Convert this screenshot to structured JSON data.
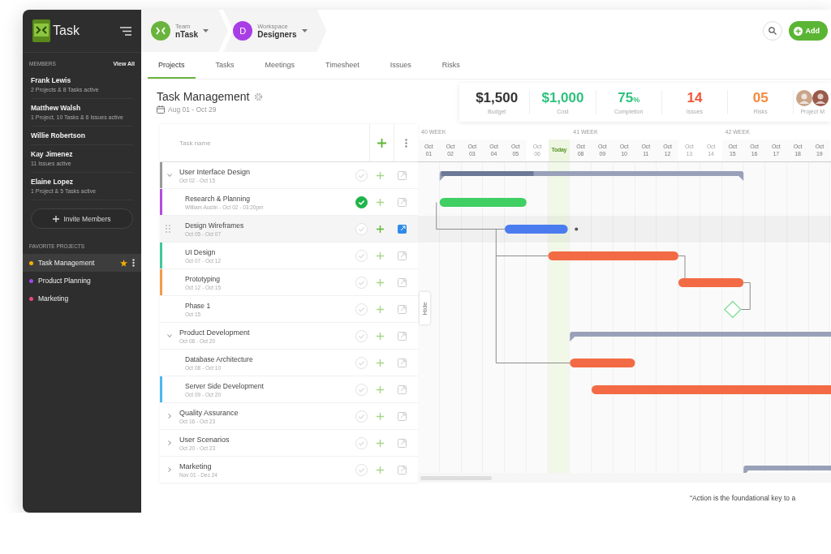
{
  "sidebar": {
    "logo_text": "Task",
    "members_heading": "MEMBERS",
    "view_all": "View All",
    "members": [
      {
        "name": "Frank Lewis",
        "detail": "2 Projects & 8 Tasks active"
      },
      {
        "name": "Matthew Walsh",
        "detail": "1 Project, 10 Tasks & 6 Issues active"
      },
      {
        "name": "Willie Robertson"
      },
      {
        "name": "Kay Jimenez",
        "detail": "11 Issues active"
      },
      {
        "name": "Elaine Lopez",
        "detail": "1 Project & 5 Tasks active"
      }
    ],
    "invite_button": "Invite Members",
    "favorites_heading": "FAVORITE PROJECTS",
    "favorites": [
      {
        "name": "Task Management",
        "color": "#f5b000",
        "selected": true,
        "starred": true
      },
      {
        "name": "Product Planning",
        "color": "#a046f0",
        "selected": false,
        "starred": false
      },
      {
        "name": "Marketing",
        "color": "#f0467a",
        "selected": false,
        "starred": false
      }
    ]
  },
  "header": {
    "team": {
      "caption": "Team",
      "name": "nTask"
    },
    "workspace": {
      "caption": "Workspace",
      "name": "Designers",
      "initial": "D"
    },
    "add_button": "Add"
  },
  "tabs": [
    {
      "label": "Projects",
      "selected": true
    },
    {
      "label": "Tasks",
      "selected": false
    },
    {
      "label": "Meetings",
      "selected": false
    },
    {
      "label": "Timesheet",
      "selected": false
    },
    {
      "label": "Issues",
      "selected": false
    },
    {
      "label": "Risks",
      "selected": false
    }
  ],
  "project": {
    "title": "Task Management",
    "dates": "Aug 01 - Oct 29"
  },
  "stats": [
    {
      "value": "$1,500",
      "label": "Budget",
      "color": "#333333"
    },
    {
      "value": "$1,000",
      "label": "Cost",
      "color": "#2ec27e"
    },
    {
      "value": "75",
      "suffix": "%",
      "label": "Completion",
      "color": "#2ec27e"
    },
    {
      "value": "14",
      "label": "Issues",
      "color": "#f0563c"
    },
    {
      "value": "05",
      "label": "Risks",
      "color": "#f5883c"
    }
  ],
  "members_label": "Project M",
  "table": {
    "column_header": "Task name",
    "rows": [
      {
        "kind": "group",
        "name": "User Interface Design",
        "dates": "Oct 02 - Oct 15",
        "expanded": true,
        "color": "#9a9a9a",
        "done": false,
        "selected": false
      },
      {
        "kind": "task",
        "name": "Research & Planning",
        "dates": "William Austin - Oct 02 - 03:20pm",
        "color": "#b44be0",
        "done": true,
        "selected": false
      },
      {
        "kind": "task",
        "name": "Design Wireframes",
        "dates": "Oct 05 - Oct 07",
        "done": false,
        "selected": true
      },
      {
        "kind": "task",
        "name": "UI Design",
        "dates": "Oct 07 - Oct 12",
        "color": "#3ec99a",
        "done": false,
        "selected": false
      },
      {
        "kind": "task",
        "name": "Prototyping",
        "dates": "Oct 12 - Oct 15",
        "color": "#f59a4a",
        "done": false,
        "selected": false
      },
      {
        "kind": "task",
        "name": "Phase 1",
        "dates": "Oct 15",
        "done": false,
        "selected": false
      },
      {
        "kind": "group",
        "name": "Product Development",
        "dates": "Oct 08 - Oct 20",
        "expanded": true,
        "done": false,
        "selected": false
      },
      {
        "kind": "task",
        "name": "Database Architecture",
        "dates": "Oct 08 - Oct 10",
        "done": false,
        "selected": false
      },
      {
        "kind": "task",
        "name": "Server Side Development",
        "dates": "Oct 09 - Oct 20",
        "color": "#4ab8f0",
        "done": false,
        "selected": false
      },
      {
        "kind": "group",
        "name": "Quality Assurance",
        "dates": "Oct 16 - Oct 23",
        "expanded": false,
        "done": false,
        "selected": false
      },
      {
        "kind": "group",
        "name": "User Scenarios",
        "dates": "Oct 20 - Oct 23",
        "expanded": false,
        "done": false,
        "selected": false
      },
      {
        "kind": "group",
        "name": "Marketing",
        "dates": "Nov 01 - Dec 24",
        "expanded": false,
        "done": false,
        "selected": false
      }
    ]
  },
  "gantt": {
    "weeks": [
      "40 WEEK",
      "41 WEEK",
      "42 WEEK"
    ],
    "days": [
      {
        "label": "Oct 01",
        "kind": "day"
      },
      {
        "label": "Oct 02",
        "kind": "day"
      },
      {
        "label": "Oct 03",
        "kind": "day"
      },
      {
        "label": "Oct 04",
        "kind": "day"
      },
      {
        "label": "Oct 05",
        "kind": "day"
      },
      {
        "label": "Oct 06",
        "kind": "weekend"
      },
      {
        "label": "Today",
        "kind": "today"
      },
      {
        "label": "Oct 08",
        "kind": "day"
      },
      {
        "label": "Oct 09",
        "kind": "day"
      },
      {
        "label": "Oct 10",
        "kind": "day"
      },
      {
        "label": "Oct 11",
        "kind": "day"
      },
      {
        "label": "Oct 12",
        "kind": "day"
      },
      {
        "label": "Oct 13",
        "kind": "weekend"
      },
      {
        "label": "Oct 14",
        "kind": "weekend"
      },
      {
        "label": "Oct 15",
        "kind": "day"
      },
      {
        "label": "Oct 16",
        "kind": "day"
      },
      {
        "label": "Oct 17",
        "kind": "day"
      },
      {
        "label": "Oct 18",
        "kind": "day"
      },
      {
        "label": "Oct 19",
        "kind": "day"
      }
    ],
    "hide_tab": "Hide"
  },
  "quote": "\"Action is the foundational key to a"
}
